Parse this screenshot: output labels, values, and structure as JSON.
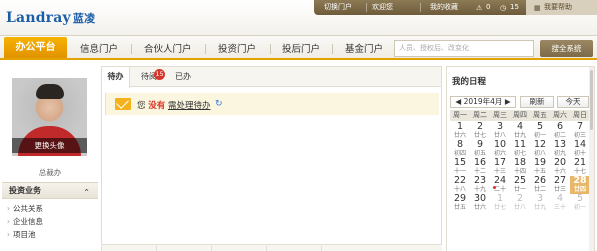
{
  "header": {
    "logo_text": "Landray",
    "logo_cn": "蓝凌",
    "top_links": [
      "切换门户",
      "欢迎您",
      "我的收藏",
      "0",
      "15",
      "我要帮助"
    ]
  },
  "nav": {
    "active": "办公平台",
    "items": [
      "信息门户",
      "合伙人门户",
      "投资门户",
      "投后门户",
      "基金门户"
    ],
    "search_placeholder": "人员、授权后、改变化",
    "search_button": "搜全系统"
  },
  "left": {
    "avatar_change": "更换头像",
    "name": "总裁办",
    "section_title": "投资业务",
    "items": [
      "公共关系",
      "企业信息",
      "项目池"
    ]
  },
  "center": {
    "tabs": [
      {
        "label": "待办"
      },
      {
        "label": "待阅",
        "badge": "15"
      },
      {
        "label": "已办"
      }
    ],
    "notice": {
      "prefix": "您",
      "highlight": "没有",
      "link": "需处理待办"
    }
  },
  "calendar": {
    "title": "我的日程",
    "month": "2019年4月",
    "refresh": "刷新",
    "today": "今天",
    "weekdays": [
      "周一",
      "周二",
      "周三",
      "周四",
      "周五",
      "周六",
      "周日"
    ],
    "weeks": [
      [
        {
          "d": "1",
          "l": "廿六"
        },
        {
          "d": "2",
          "l": "廿七"
        },
        {
          "d": "3",
          "l": "廿八"
        },
        {
          "d": "4",
          "l": "廿九"
        },
        {
          "d": "5",
          "l": "初一"
        },
        {
          "d": "6",
          "l": "初二"
        },
        {
          "d": "7",
          "l": "初三"
        }
      ],
      [
        {
          "d": "8",
          "l": "初四"
        },
        {
          "d": "9",
          "l": "初五"
        },
        {
          "d": "10",
          "l": "初六"
        },
        {
          "d": "11",
          "l": "初七"
        },
        {
          "d": "12",
          "l": "初八"
        },
        {
          "d": "13",
          "l": "初九"
        },
        {
          "d": "14",
          "l": "初十"
        }
      ],
      [
        {
          "d": "15",
          "l": "十一"
        },
        {
          "d": "16",
          "l": "十二"
        },
        {
          "d": "17",
          "l": "十三"
        },
        {
          "d": "18",
          "l": "十四"
        },
        {
          "d": "19",
          "l": "十五"
        },
        {
          "d": "20",
          "l": "十六"
        },
        {
          "d": "21",
          "l": "十七"
        }
      ],
      [
        {
          "d": "22",
          "l": "十八"
        },
        {
          "d": "23",
          "l": "十九"
        },
        {
          "d": "24",
          "l": "二十"
        },
        {
          "d": "25",
          "l": "廿一"
        },
        {
          "d": "26",
          "l": "廿二"
        },
        {
          "d": "27",
          "l": "廿三"
        },
        {
          "d": "28",
          "l": "廿四"
        }
      ],
      [
        {
          "d": "29",
          "l": "廿五"
        },
        {
          "d": "30",
          "l": "廿六"
        },
        {
          "d": "1",
          "l": "廿七"
        },
        {
          "d": "2",
          "l": "廿八"
        },
        {
          "d": "3",
          "l": "廿九"
        },
        {
          "d": "4",
          "l": "三十"
        },
        {
          "d": "5",
          "l": "初一"
        }
      ]
    ]
  }
}
